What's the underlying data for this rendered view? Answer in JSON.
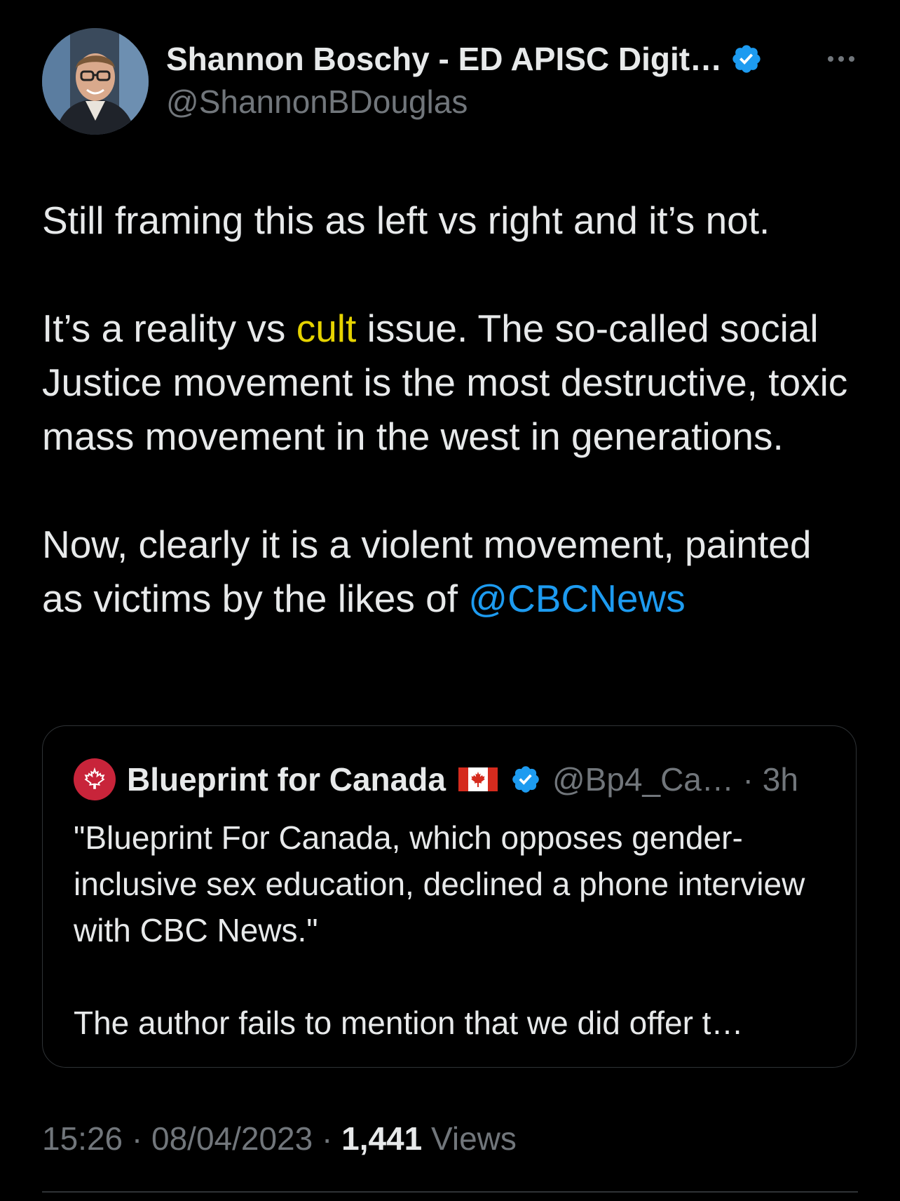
{
  "author": {
    "name": "Shannon Boschy - ED APISC Digit…",
    "handle": "@ShannonBDouglas"
  },
  "tweet": {
    "p1": "Still framing this as left vs right and it’s not.",
    "p2_before": "It’s a reality vs ",
    "p2_highlight": "cult",
    "p2_after": " issue. The so-called social Justice movement is the most destructive, toxic mass movement in the west in generations.",
    "p3_before": "Now, clearly it is a violent movement, painted as victims by the likes of ",
    "p3_mention": "@CBCNews"
  },
  "quote": {
    "name": "Blueprint for Canada",
    "handle_time": "@Bp4_Ca… · 3h",
    "p1": "\"Blueprint For Canada, which opposes gender-inclusive sex education, declined a phone interview with CBC News.\"",
    "p2": "The author fails to mention that we did offer t…"
  },
  "meta": {
    "time_date": "15:26 · 08/04/2023 · ",
    "views_count": "1,441",
    "views_label": " Views"
  },
  "colors": {
    "background": "#000000",
    "text": "#e7e9ea",
    "muted": "#71767b",
    "link": "#1d9bf0",
    "highlight": "#e6d300",
    "verified": "#1d9bf0",
    "border": "#2f3336"
  },
  "icons": {
    "verified": "verified-badge-icon",
    "more": "more-horizontal-icon",
    "flag": "canada-flag-icon",
    "quote_avatar": "maple-leaf-icon"
  }
}
